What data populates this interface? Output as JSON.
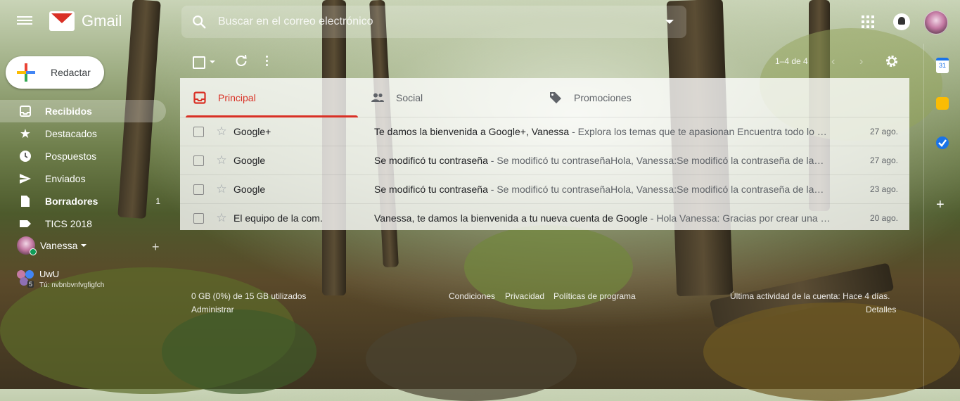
{
  "header": {
    "app_name": "Gmail",
    "search_placeholder": "Buscar en el correo electrónico"
  },
  "sidebar": {
    "compose_label": "Redactar",
    "items": [
      {
        "label": "Recibidos",
        "count": "",
        "icon": "inbox-icon",
        "active": true
      },
      {
        "label": "Destacados",
        "count": "",
        "icon": "star-icon",
        "active": false
      },
      {
        "label": "Pospuestos",
        "count": "",
        "icon": "clock-icon",
        "active": false
      },
      {
        "label": "Enviados",
        "count": "",
        "icon": "send-icon",
        "active": false
      },
      {
        "label": "Borradores",
        "count": "1",
        "icon": "draft-icon",
        "active": false
      },
      {
        "label": "TICS 2018",
        "count": "",
        "icon": "label-icon",
        "active": false
      }
    ]
  },
  "hangouts": {
    "user_name": "Vanessa",
    "group_name": "UwU",
    "group_subtitle": "Tú: nvbnbvnfvgfigfch",
    "group_count": "5"
  },
  "toolbar": {
    "pager": "1–4 de 4"
  },
  "tabs": [
    {
      "label": "Principal",
      "icon": "inbox-tab-icon",
      "active": true
    },
    {
      "label": "Social",
      "icon": "people-icon",
      "active": false
    },
    {
      "label": "Promociones",
      "icon": "tag-icon",
      "active": false
    }
  ],
  "emails": [
    {
      "sender": "Google+",
      "subject": "Te damos la bienvenida a Google+, Vanessa",
      "snippet": " - Explora los temas que te apasionan Encuentra todo lo …",
      "date": "27 ago."
    },
    {
      "sender": "Google",
      "subject": "Se modificó tu contraseña",
      "snippet": " - Se modificó tu contraseñaHola, Vanessa:Se modificó la contraseña de la…",
      "date": "27 ago."
    },
    {
      "sender": "Google",
      "subject": "Se modificó tu contraseña",
      "snippet": " - Se modificó tu contraseñaHola, Vanessa:Se modificó la contraseña de la…",
      "date": "23 ago."
    },
    {
      "sender": "El equipo de la com.",
      "subject": "Vanessa, te damos la bienvenida a tu nueva cuenta de Google",
      "snippet": " - Hola Vanessa: Gracias por crear una …",
      "date": "20 ago."
    }
  ],
  "footer": {
    "storage": "0 GB (0%) de 15 GB utilizados",
    "manage": "Administrar",
    "terms": "Condiciones",
    "privacy": "Privacidad",
    "policies": "Políticas de programa",
    "activity": "Última actividad de la cuenta: Hace 4 días.",
    "details": "Detalles"
  },
  "side_panel": {
    "calendar_day": "31"
  },
  "colors": {
    "accent": "#d93025",
    "compose_bg": "#ffffff",
    "online": "#0f9d58"
  }
}
